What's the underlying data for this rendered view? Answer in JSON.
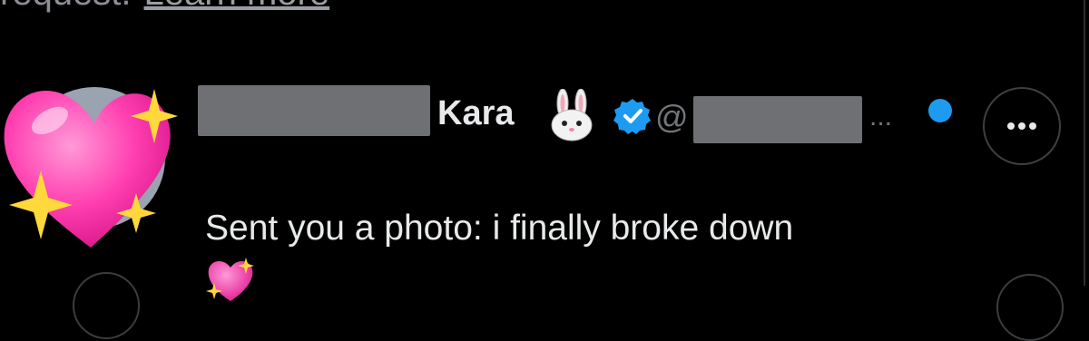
{
  "notice": {
    "text": "request.",
    "link": "Learn more"
  },
  "conversation": {
    "display_name_visible": "Kara",
    "handle_prefix": "@",
    "handle_truncation": "...",
    "message_preview": "Sent you a photo: i finally broke down",
    "emojis": [
      "rabbit-face",
      "blue-verified-badge",
      "sparkling-heart"
    ],
    "avatar_icon": "sparkling-heart-sticker",
    "unread": true,
    "more_button_icon": "more-horizontal-icon"
  },
  "colors": {
    "background": "#000000",
    "primary_text": "#e7e9ea",
    "secondary_text": "#71767b",
    "accent_blue": "#1d9bf0",
    "redaction_gray": "#6e7073",
    "heart_pink": "#ff4fb8",
    "sparkle_yellow": "#ffd83b"
  }
}
